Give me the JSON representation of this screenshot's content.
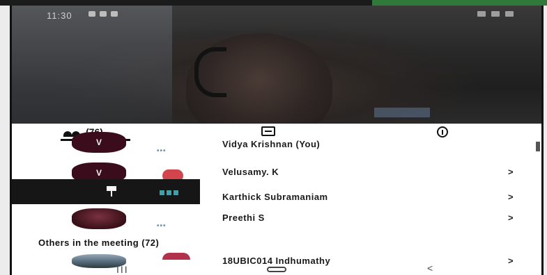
{
  "status_bar": {
    "time": "11:30"
  },
  "tabs": {
    "people_count": "(76)",
    "chat_icon": "chat-icon",
    "info_icon": "info-icon"
  },
  "participants": [
    {
      "initial": "V",
      "name": "Vidya Krishnan (You)",
      "chevron": ""
    },
    {
      "initial": "V",
      "name": "Velusamy. K",
      "chevron": ">"
    },
    {
      "initial": "",
      "name": "Karthick Subramaniam",
      "chevron": ">"
    },
    {
      "initial": "",
      "name": "Preethi S",
      "chevron": ">"
    }
  ],
  "others_section": {
    "label": "Others in the meeting (72)"
  },
  "others": [
    {
      "initial": "",
      "name": "18UBIC014 Indhumathy",
      "chevron": ">"
    }
  ],
  "nav_bar": {
    "recents": "III",
    "back": "<"
  },
  "colors": {
    "avatar": "#3b0d1c",
    "mute_badge": "#d2454c",
    "pin_dots": "#3ea0a8",
    "pin_bar": "#161616"
  }
}
